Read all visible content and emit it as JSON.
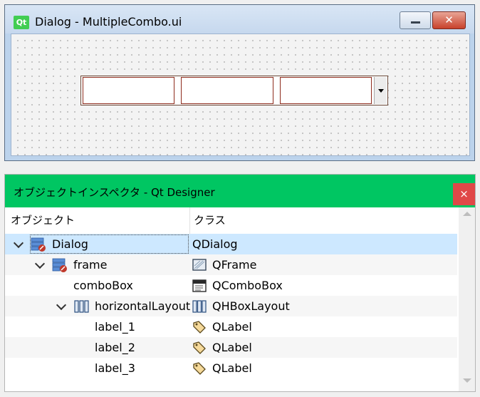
{
  "form_window": {
    "logo_text": "Qt",
    "title": "Dialog - MultipleCombo.ui",
    "close_label": "✕"
  },
  "inspector": {
    "title": "オブジェクトインスペクタ - Qt Designer",
    "close_label": "×",
    "columns": {
      "object": "オブジェクト",
      "class": "クラス"
    },
    "rows": [
      {
        "name": "Dialog",
        "class": "QDialog"
      },
      {
        "name": "frame",
        "class": "QFrame"
      },
      {
        "name": "comboBox",
        "class": "QComboBox"
      },
      {
        "name": "horizontalLayout",
        "class": "QHBoxLayout"
      },
      {
        "name": "label_1",
        "class": "QLabel"
      },
      {
        "name": "label_2",
        "class": "QLabel"
      },
      {
        "name": "label_3",
        "class": "QLabel"
      }
    ]
  },
  "colors": {
    "inspector_header": "#00c662",
    "selection": "#cde8ff",
    "qt_green": "#41cd52"
  }
}
